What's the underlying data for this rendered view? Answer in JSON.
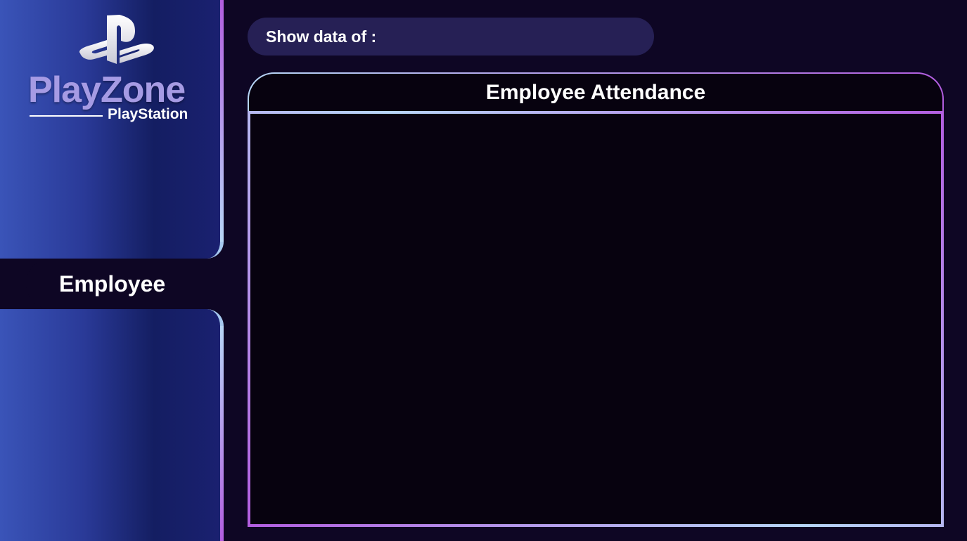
{
  "sidebar": {
    "brand": {
      "icon": "playstation-logo-icon",
      "name": "PlayZone",
      "subtitle": "PlayStation"
    },
    "nav": {
      "items": [
        {
          "label": "Employee",
          "active": true
        }
      ]
    }
  },
  "main": {
    "filter": {
      "label": "Show data of :"
    },
    "card": {
      "title": "Employee Attendance"
    }
  },
  "colors": {
    "background": "#0e0624",
    "sidebar_gradient_start": "#3a54b8",
    "sidebar_gradient_end": "#141e62",
    "accent_blue": "#b7d6f7",
    "accent_purple": "#b25de0",
    "filter_bar": "#262055",
    "card_body": "#07020f"
  }
}
